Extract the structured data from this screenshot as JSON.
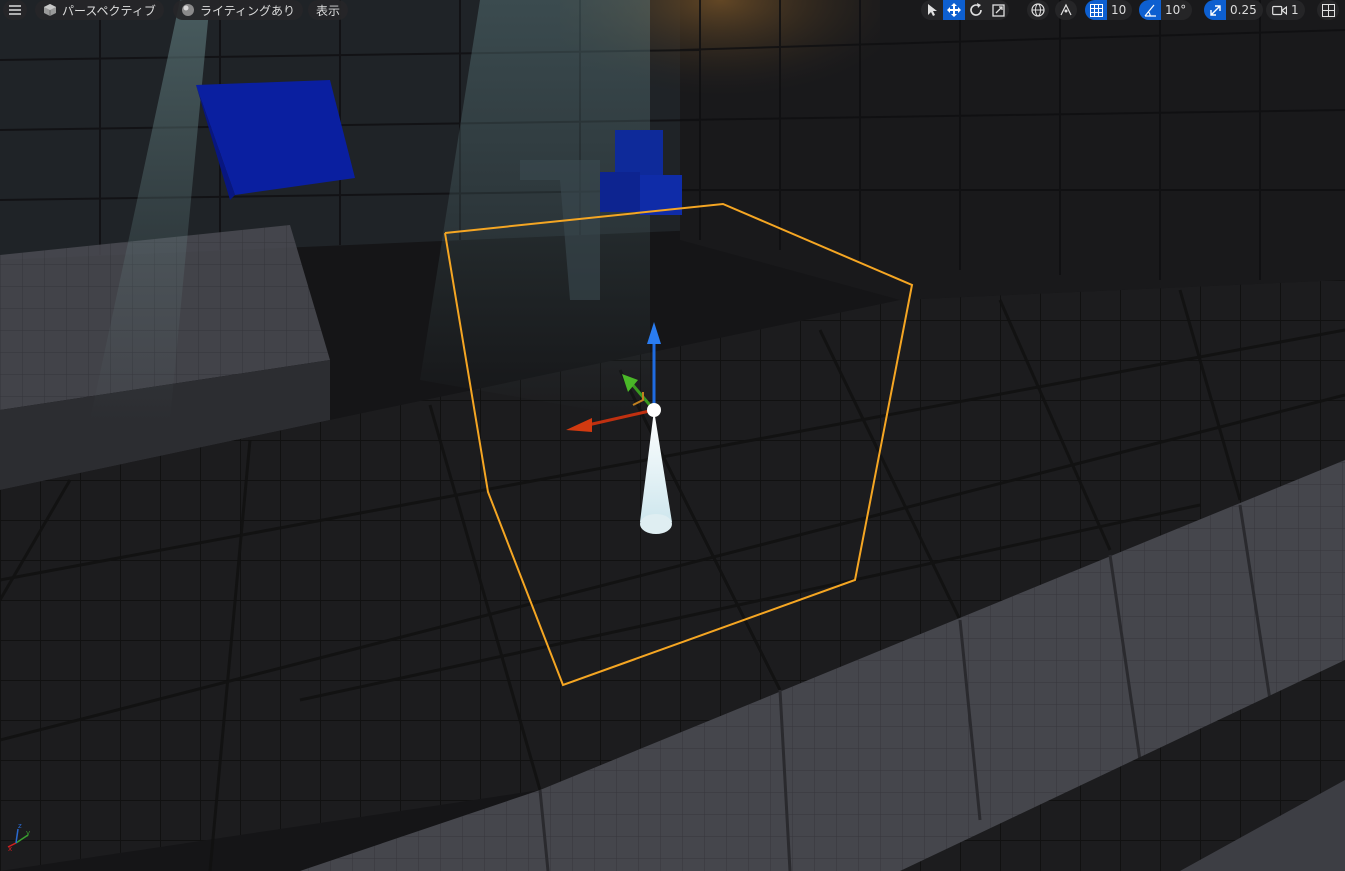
{
  "toolbar": {
    "menu_icon": "hamburger-icon",
    "perspective_label": "パースペクティブ",
    "lighting_label": "ライティングあり",
    "show_label": "表示",
    "grid_snap_value": "10",
    "rotation_snap_value": "10°",
    "scale_snap_value": "0.25",
    "camera_speed_value": "1",
    "colors": {
      "accent": "#0d5fd0",
      "selection": "#f5a623"
    }
  }
}
